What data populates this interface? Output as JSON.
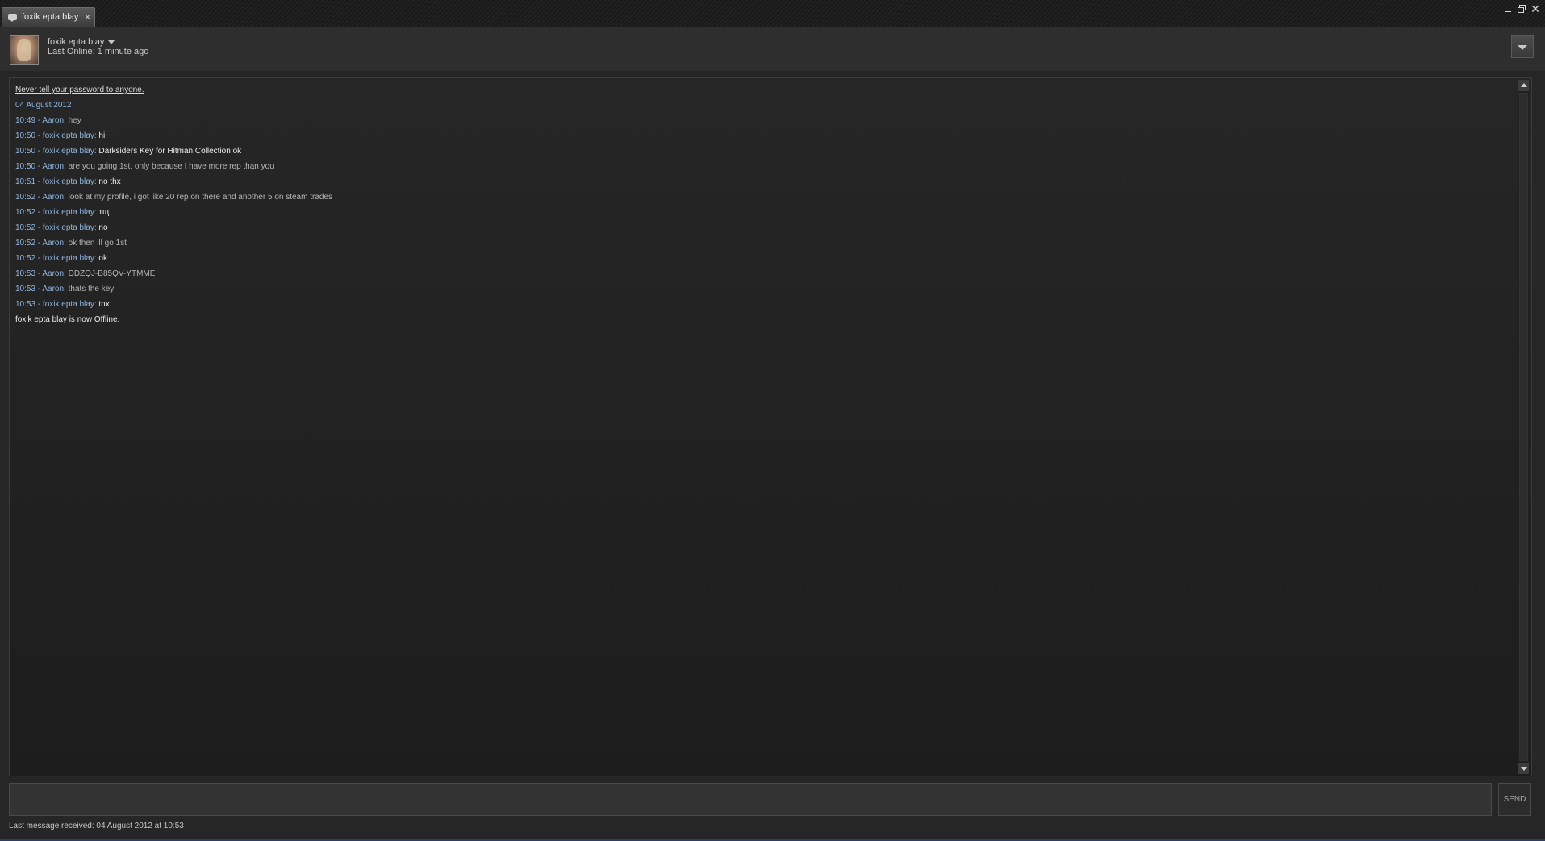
{
  "window": {
    "tab_title": "foxik epta blay",
    "tab_close": "×",
    "close_glyph": "✕"
  },
  "header": {
    "user_name": "foxik epta blay",
    "status": "Last Online: 1 minute ago"
  },
  "chat": {
    "warning": "Never tell your password to anyone.",
    "date": "04 August 2012",
    "messages": [
      {
        "meta": "10:49 - Aaron: ",
        "text": "hey",
        "sender": "Aaron"
      },
      {
        "meta": "10:50 - foxik epta blay: ",
        "text": "hi",
        "sender": "foxik"
      },
      {
        "meta": "10:50 - foxik epta blay: ",
        "text": "Darksiders Key for Hitman Collection ok",
        "sender": "foxik"
      },
      {
        "meta": "10:50 - Aaron: ",
        "text": "are you going 1st, only because I have more rep than you",
        "sender": "Aaron"
      },
      {
        "meta": "10:51 - foxik epta blay: ",
        "text": "no thx",
        "sender": "foxik"
      },
      {
        "meta": "10:52 - Aaron: ",
        "text": "look at my profile, i got like 20 rep on there and another 5 on steam trades",
        "sender": "Aaron"
      },
      {
        "meta": "10:52 - foxik epta blay: ",
        "text": "тщ",
        "sender": "foxik"
      },
      {
        "meta": "10:52 - foxik epta blay: ",
        "text": "no",
        "sender": "foxik"
      },
      {
        "meta": "10:52 - Aaron: ",
        "text": "ok then ill go 1st",
        "sender": "Aaron"
      },
      {
        "meta": "10:52 - foxik epta blay: ",
        "text": "ok",
        "sender": "foxik"
      },
      {
        "meta": "10:53 - Aaron: ",
        "text": "DDZQJ-B85QV-YTMME",
        "sender": "Aaron"
      },
      {
        "meta": "10:53 - Aaron: ",
        "text": "thats the key",
        "sender": "Aaron"
      },
      {
        "meta": "10:53 - foxik epta blay: ",
        "text": "tnx",
        "sender": "foxik"
      }
    ],
    "offline_notice": "foxik epta blay is now Offline."
  },
  "composer": {
    "value": "",
    "send_label": "SEND"
  },
  "footer": {
    "last_received": "Last message received: 04 August 2012 at 10:53"
  },
  "icons": {
    "tab_icon": "chat-bubble-icon",
    "minimize": "minimize-icon",
    "maximize": "maximize-icon",
    "close": "close-icon",
    "dropdown": "chevron-down-icon"
  },
  "colors": {
    "timestamp": "#8fb6de",
    "background": "#262626"
  }
}
